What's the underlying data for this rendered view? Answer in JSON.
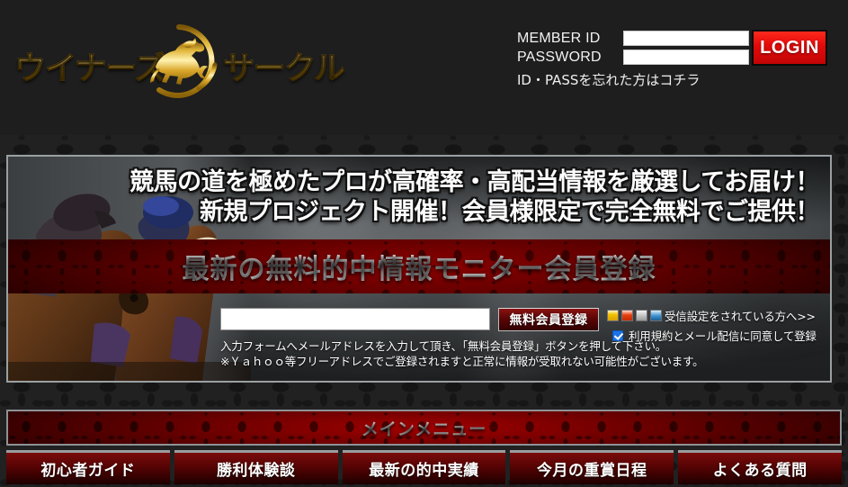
{
  "header": {
    "logo": {
      "text_left": "ウイナーズ",
      "text_right": "サークル",
      "emblem_name": "horse-and-rider-circle-emblem"
    },
    "login": {
      "member_id_label": "MEMBER ID",
      "member_id_value": "",
      "member_id_placeholder": "",
      "password_label": "PASSWORD",
      "password_value": "",
      "password_placeholder": "",
      "login_button_label": "LOGIN",
      "forgot_link": "ID・PASSを忘れた方はコチラ"
    }
  },
  "banner": {
    "headline_line1": "競馬の道を極めたプロが高確率・高配当情報を厳選してお届け！",
    "headline_line2": "新規プロジェクト開催！会員様限定で完全無料でご提供！",
    "red_band_title": "最新の無料的中情報モニター会員登録",
    "form": {
      "email_value": "",
      "email_placeholder": "",
      "register_button_label": "無料会員登録",
      "carrier_icons": [
        "imode-icon",
        "ezweb-icon",
        "softbank-icon",
        "pc-mail-icon"
      ],
      "carrier_link": "受信設定をされている方へ>>",
      "agree_checked": true,
      "agree_label": "利用規約とメール配信に同意して登録",
      "note_line1": "入力フォームへメールアドレスを入力して頂き、「無料会員登録」ボタンを押して下さい。",
      "note_line2": "※Ｙａｈｏｏ等フリーアドレスでご登録されますと正常に情報が受取れない可能性がございます。"
    }
  },
  "main_menu": {
    "header_title": "メインメニュー",
    "tabs": [
      {
        "label": "初心者ガイド"
      },
      {
        "label": "勝利体験談"
      },
      {
        "label": "最新の的中実績"
      },
      {
        "label": "今月の重賞日程"
      },
      {
        "label": "よくある質問"
      }
    ]
  },
  "colors": {
    "page_background": "#212121",
    "header_background": "#1e1e1e",
    "login_button_red": "#e30a0a",
    "band_red": "#8d0000",
    "menu_tab_red": "#5a0404",
    "gold": "#e5bc3a",
    "border_silver": "#9aa0a2",
    "checkbox_blue": "#1a73e8"
  }
}
